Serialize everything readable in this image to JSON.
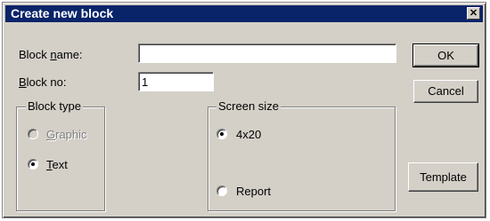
{
  "dialog": {
    "title": "Create new block",
    "close_glyph": "✕"
  },
  "fields": {
    "block_name": {
      "label_pre": "Block ",
      "label_u": "n",
      "label_post": "ame:",
      "value": ""
    },
    "block_no": {
      "label_pre": "",
      "label_u": "B",
      "label_post": "lock no:",
      "value": "1"
    }
  },
  "block_type": {
    "legend": "Block type",
    "options": [
      {
        "label_u": "G",
        "label_rest": "raphic",
        "selected": false,
        "enabled": false
      },
      {
        "label_u": "T",
        "label_rest": "ext",
        "selected": true,
        "enabled": true
      }
    ]
  },
  "screen_size": {
    "legend": "Screen size",
    "options": [
      {
        "label": "4x20",
        "selected": true
      },
      {
        "label": "Report",
        "selected": false
      }
    ]
  },
  "buttons": {
    "ok": "OK",
    "cancel": "Cancel",
    "template": "Template"
  }
}
